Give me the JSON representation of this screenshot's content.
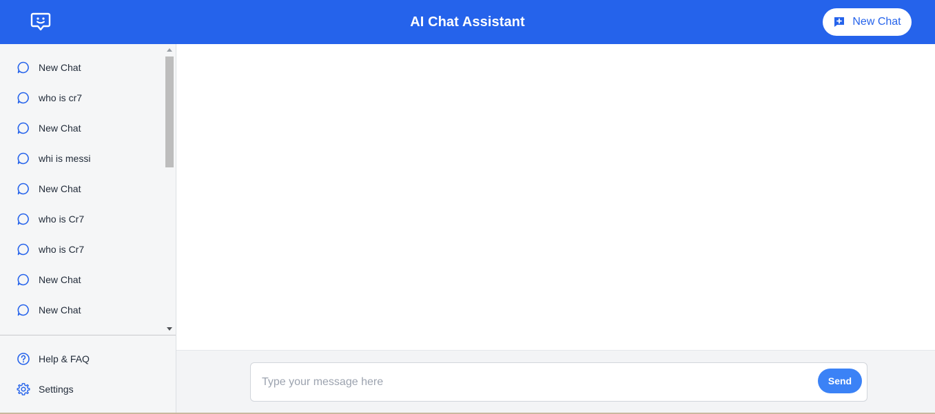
{
  "header": {
    "title": "AI Chat Assistant",
    "new_chat_label": "New Chat",
    "logo_icon": "chat-bot-icon",
    "accent_color": "#2563eb"
  },
  "sidebar": {
    "history": [
      {
        "label": "New Chat"
      },
      {
        "label": "who is cr7"
      },
      {
        "label": "New Chat"
      },
      {
        "label": "whi is messi"
      },
      {
        "label": "New Chat"
      },
      {
        "label": "who is Cr7"
      },
      {
        "label": "who is Cr7"
      },
      {
        "label": "New Chat"
      },
      {
        "label": "New Chat"
      }
    ],
    "item_icon": "chat-bubble-icon",
    "footer": {
      "help_label": "Help & FAQ",
      "settings_label": "Settings"
    }
  },
  "composer": {
    "placeholder": "Type your message here",
    "value": "",
    "send_label": "Send"
  }
}
